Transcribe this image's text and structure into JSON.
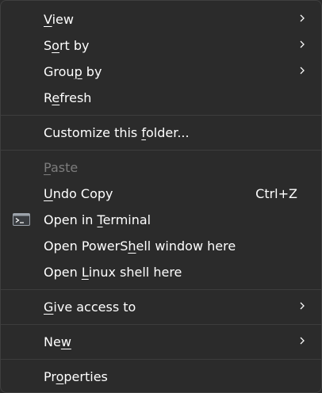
{
  "menu": {
    "items": [
      {
        "id": "view",
        "pre": "",
        "ul": "V",
        "post": "iew",
        "submenu": true
      },
      {
        "id": "sort-by",
        "pre": "S",
        "ul": "o",
        "post": "rt by",
        "submenu": true
      },
      {
        "id": "group-by",
        "pre": "Grou",
        "ul": "p",
        "post": " by",
        "submenu": true
      },
      {
        "id": "refresh",
        "pre": "R",
        "ul": "e",
        "post": "fresh"
      },
      {
        "id": "customize-folder",
        "pre": "Customize this ",
        "ul": "f",
        "post": "older..."
      },
      {
        "id": "paste",
        "pre": "",
        "ul": "P",
        "post": "aste",
        "disabled": true
      },
      {
        "id": "undo-copy",
        "pre": "",
        "ul": "U",
        "post": "ndo Copy",
        "shortcut": "Ctrl+Z"
      },
      {
        "id": "open-in-terminal",
        "pre": "Open in ",
        "ul": "T",
        "post": "erminal",
        "icon": "terminal-icon"
      },
      {
        "id": "open-powershell",
        "pre": "Open PowerS",
        "ul": "h",
        "post": "ell window here"
      },
      {
        "id": "open-linux-shell",
        "pre": "Open ",
        "ul": "L",
        "post": "inux shell here"
      },
      {
        "id": "give-access",
        "pre": "",
        "ul": "G",
        "post": "ive access to",
        "submenu": true
      },
      {
        "id": "new",
        "pre": "Ne",
        "ul": "w",
        "post": "",
        "submenu": true
      },
      {
        "id": "properties",
        "pre": "Pr",
        "ul": "o",
        "post": "perties"
      }
    ]
  },
  "colors": {
    "background": "#2b2b2b",
    "text": "#ffffff",
    "disabled_text": "#7d7d7d",
    "separator": "#3d3d3d",
    "terminal_icon": "#9ca3ab"
  }
}
